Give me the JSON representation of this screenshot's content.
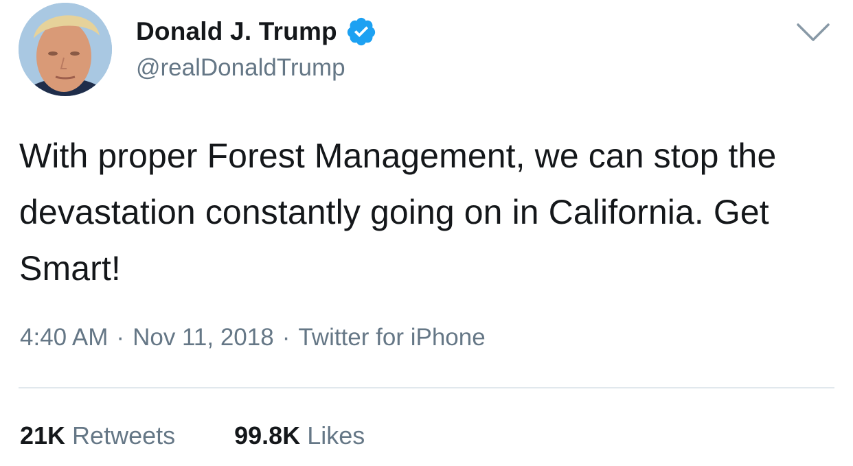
{
  "tweet": {
    "author": {
      "display_name": "Donald J. Trump",
      "handle": "@realDonaldTrump",
      "verified": true
    },
    "text": "With proper Forest Management, we can stop the devastation constantly going on in California. Get Smart!",
    "time": "4:40 AM",
    "date": "Nov 11, 2018",
    "source": "Twitter for iPhone",
    "separator": "·",
    "stats": {
      "retweets_count": "21K",
      "retweets_label": "Retweets",
      "likes_count": "99.8K",
      "likes_label": "Likes"
    }
  },
  "icons": {
    "verified": "verified-badge-icon",
    "menu": "chevron-down-icon"
  },
  "colors": {
    "text_primary": "#14171a",
    "text_secondary": "#657786",
    "verified_blue": "#1da1f2",
    "divider": "#e1e8ed",
    "background": "#ffffff"
  }
}
